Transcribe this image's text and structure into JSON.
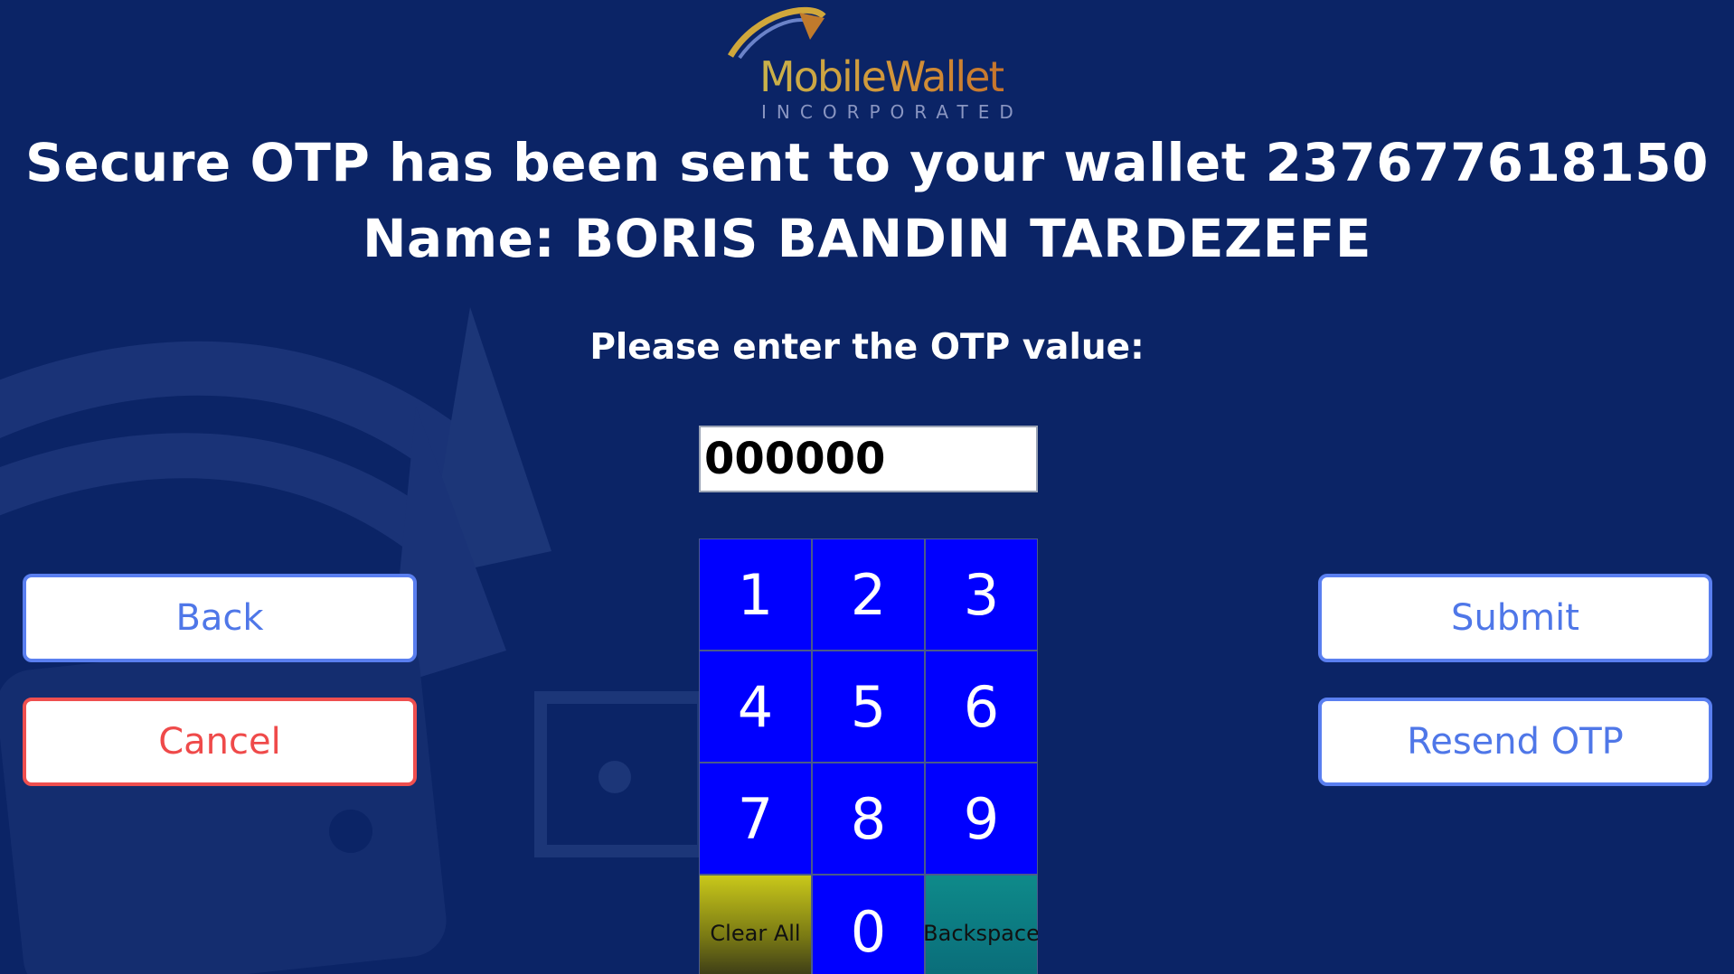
{
  "brand": {
    "name": "MobileWallet",
    "subtitle": "INCORPORATED"
  },
  "header": {
    "line1": "Secure OTP has been sent to your wallet 237677618150",
    "line2": "Name: BORIS BANDIN TARDEZEFE"
  },
  "prompt": "Please enter the OTP value:",
  "otp": {
    "value": "000000"
  },
  "keypad": {
    "keys": [
      "1",
      "2",
      "3",
      "4",
      "5",
      "6",
      "7",
      "8",
      "9",
      "Clear All",
      "0",
      "Backspace"
    ]
  },
  "buttons": {
    "back": "Back",
    "cancel": "Cancel",
    "submit": "Submit",
    "resend": "Resend OTP"
  },
  "colors": {
    "background": "#0b2466",
    "key_blue": "#0000ff",
    "button_blue": "#4f77e8",
    "button_red": "#ef4a4a",
    "clear_key": "#c9c81a",
    "backspace_key": "#0e8a8a"
  }
}
